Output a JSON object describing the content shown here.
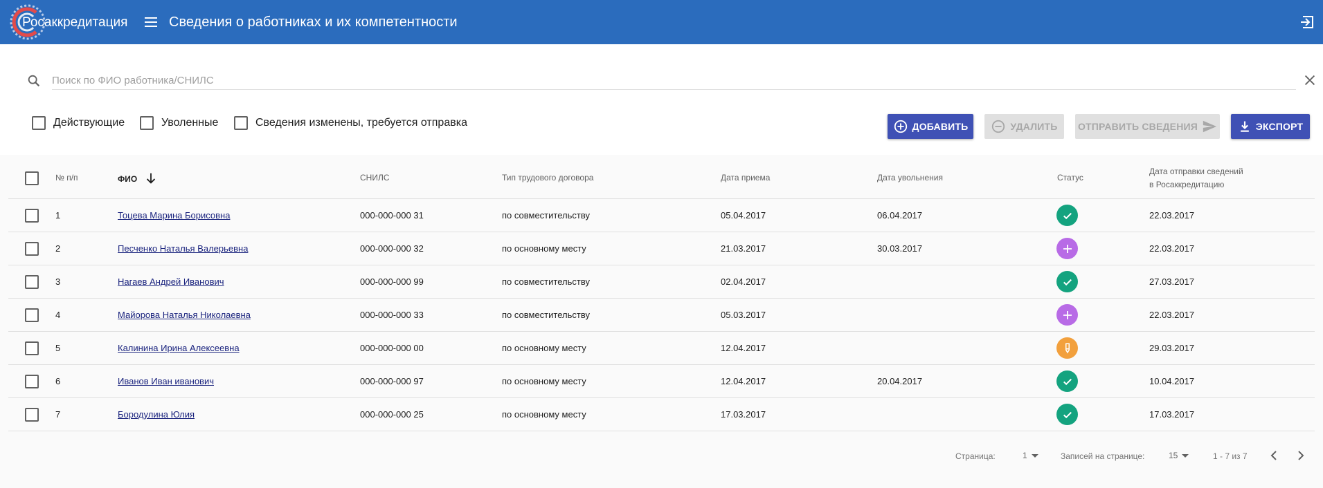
{
  "header": {
    "brand": "Росаккредитация",
    "title": "Сведения о работниках и их компетентности",
    "bg_color": "#2b6cbd"
  },
  "search": {
    "placeholder": "Поиск по ФИО работника/СНИЛС",
    "value": ""
  },
  "filters": [
    {
      "label": "Действующие",
      "checked": false
    },
    {
      "label": "Уволенные",
      "checked": false
    },
    {
      "label": "Сведения изменены, требуется отправка",
      "checked": false
    }
  ],
  "actions": {
    "add": "ДОБАВИТЬ",
    "delete": "УДАЛИТЬ",
    "send": "ОТПРАВИТЬ СВЕДЕНИЯ",
    "export": "ЭКСПОРТ",
    "primary_color": "#3f51b5"
  },
  "table": {
    "columns": {
      "num": "№ п/п",
      "fio": "ФИО",
      "snils": "СНИЛС",
      "contract": "Тип трудового договора",
      "hire": "Дата приема",
      "fire": "Дата увольнения",
      "status": "Статус",
      "sent_line1": "Дата отправки сведений",
      "sent_line2": "в Росаккредитацию"
    },
    "sort": {
      "column": "fio",
      "direction": "desc"
    },
    "rows": [
      {
        "num": "1",
        "fio": "Тоцева Марина Борисовна",
        "snils": "000-000-000 31",
        "contract": "по совместительству",
        "hire": "05.04.2017",
        "fire": "06.04.2017",
        "status": "check",
        "sent": "22.03.2017"
      },
      {
        "num": "2",
        "fio": "Песченко Наталья Валерьевна",
        "snils": "000-000-000 32",
        "contract": "по основному месту",
        "hire": "21.03.2017",
        "fire": "30.03.2017",
        "status": "plus",
        "sent": "22.03.2017"
      },
      {
        "num": "3",
        "fio": "Нагаев Андрей Иванович",
        "snils": "000-000-000 99",
        "contract": "по совместительству",
        "hire": "02.04.2017",
        "fire": "",
        "status": "check",
        "sent": "27.03.2017"
      },
      {
        "num": "4",
        "fio": "Майорова Наталья Николаевна",
        "snils": "000-000-000 33",
        "contract": "по совместительству",
        "hire": "05.03.2017",
        "fire": "",
        "status": "plus",
        "sent": "22.03.2017"
      },
      {
        "num": "5",
        "fio": "Калинина Ирина Алексеевна",
        "snils": "000-000-000 00",
        "contract": "по основному месту",
        "hire": "12.04.2017",
        "fire": "",
        "status": "edit",
        "sent": "29.03.2017"
      },
      {
        "num": "6",
        "fio": "Иванов Иван иванович",
        "snils": "000-000-000 97",
        "contract": "по основному месту",
        "hire": "12.04.2017",
        "fire": "20.04.2017",
        "status": "check",
        "sent": "10.04.2017"
      },
      {
        "num": "7",
        "fio": "Бородулина Юлия",
        "snils": "000-000-000 25",
        "contract": "по основному месту",
        "hire": "17.03.2017",
        "fire": "",
        "status": "check",
        "sent": "17.03.2017"
      }
    ],
    "status_colors": {
      "check": "#14a37f",
      "plus": "#b86be6",
      "edit": "#f2a03d"
    }
  },
  "pagination": {
    "page_label": "Страница:",
    "page": "1",
    "per_page_label": "Записей на странице:",
    "per_page": "15",
    "range": "1 - 7 из 7"
  }
}
